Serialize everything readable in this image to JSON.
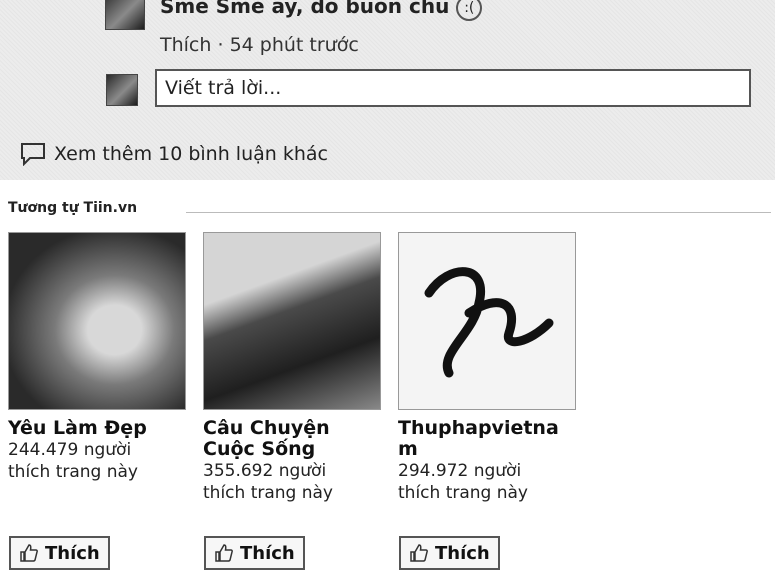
{
  "comment": {
    "text": "Sme Sme ay, do buon chu",
    "emoticon": ":(",
    "like_link": "Thích",
    "separator": "·",
    "time": "54 phút trước"
  },
  "reply": {
    "placeholder": "Viết trả lời..."
  },
  "more_comments": "Xem thêm 10 bình luận khác",
  "similar": {
    "title": "Tương tự Tiin.vn",
    "pages": [
      {
        "name": "Yêu Làm Đẹp",
        "likes_line1": "244.479 người",
        "likes_line2": "thích trang này",
        "like_label": "Thích"
      },
      {
        "name": "Câu Chuyện Cuộc Sống",
        "likes_line1": "355.692 người",
        "likes_line2": "thích trang này",
        "like_label": "Thích"
      },
      {
        "name": "Thuphapvietnam",
        "likes_line1": "294.972 người",
        "likes_line2": "thích trang này",
        "like_label": "Thích"
      }
    ]
  }
}
